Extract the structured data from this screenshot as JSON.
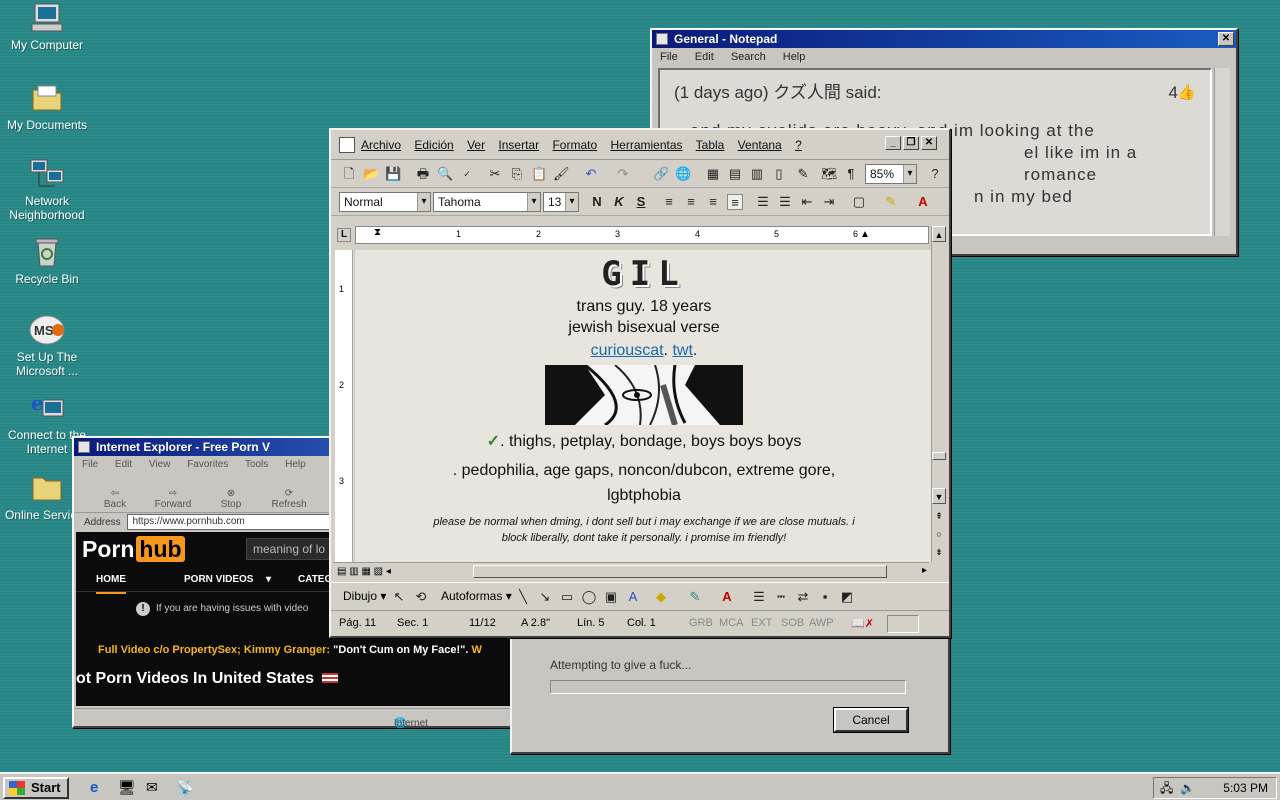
{
  "desktop": {
    "icons": [
      {
        "label": "My Computer",
        "icon": "computer-icon"
      },
      {
        "label": "My Documents",
        "icon": "folder-icon"
      },
      {
        "label": "Network Neighborhood",
        "icon": "network-icon"
      },
      {
        "label": "Recycle Bin",
        "icon": "recycle-bin-icon"
      },
      {
        "label": "Set Up The Microsoft ...",
        "icon": "msn-icon"
      },
      {
        "label": "Connect to the Internet",
        "icon": "internet-icon"
      },
      {
        "label": "Online Services",
        "icon": "folder-icon"
      }
    ]
  },
  "notepad": {
    "title": "General - Notepad",
    "menu": [
      "File",
      "Edit",
      "Search",
      "Help"
    ],
    "header": "(1 days ago) クズ人間 said:",
    "likes": "4",
    "body_line1": "and my eyelids are heavy, and im looking at the",
    "body_line2": "el like im in a romance",
    "body_line3": "n in my bed"
  },
  "ie": {
    "title": "Internet Explorer - Free Porn V",
    "menu": [
      "File",
      "Edit",
      "View",
      "Favorites",
      "Tools",
      "Help"
    ],
    "toolbar": [
      "Back",
      "Forward",
      "Stop",
      "Refresh",
      "Ho"
    ],
    "address_label": "Address",
    "address": "https://www.pornhub.com",
    "logo_left": "Porn",
    "logo_right": "hub",
    "search_placeholder": "meaning of lo",
    "nav": [
      "HOME",
      "PORN VIDEOS",
      "CATEG"
    ],
    "notice": "If you are having issues with video",
    "promo_yellow": "Full Video c/o PropertySex; Kimmy Granger:",
    "promo_white": "\"Don't Cum on My Face!\".",
    "promo_tail": "W",
    "heading": "ot Porn Videos In United States",
    "status": "Internet"
  },
  "dialog": {
    "text": "Attempting to give a fuck...",
    "cancel": "Cancel"
  },
  "word": {
    "menu": [
      "Archivo",
      "Edición",
      "Ver",
      "Insertar",
      "Formato",
      "Herramientas",
      "Tabla",
      "Ventana",
      "?"
    ],
    "zoom": "85%",
    "style": "Normal",
    "font": "Tahoma",
    "size": "13",
    "ruler_numbers": [
      "1",
      "2",
      "3",
      "4",
      "5",
      "6"
    ],
    "vruler_numbers": [
      "1",
      "2",
      "3"
    ],
    "doc": {
      "title": "GIL",
      "line1": "trans guy. 18 years",
      "line2": "jewish bisexual verse",
      "link1": "curiouscat",
      "sep": ".",
      "link2": "twt",
      "end": ".",
      "check": "✓",
      "likes": ". thighs, petplay, bondage, boys boys boys",
      "dislikes_1": ". pedophilia, age gaps, noncon/dubcon, extreme gore,",
      "dislikes_2": "lgbtphobia",
      "small_1": "please be normal when dming, i dont sell but i may exchange if we are close mutuals. i",
      "small_2": "block liberally, dont take it personally. i promise im friendly!"
    },
    "draw": {
      "dibujo": "Dibujo",
      "autoformas": "Autoformas"
    },
    "status": {
      "pag": "Pág. 11",
      "sec": "Sec. 1",
      "pages": "11/12",
      "at": "A 2.8\"",
      "lin": "Lín. 5",
      "col": "Col. 1",
      "grb": "GRB",
      "mca": "MCA",
      "ext": "EXT",
      "sob": "SOB",
      "awp": "AWP"
    }
  },
  "taskbar": {
    "start": "Start",
    "clock": "5:03 PM"
  },
  "colors": {
    "desktop": "#2b8a8a",
    "titlebar": "#0a1a7a",
    "link": "#1a6ab0",
    "hub_orange": "#f7971d"
  }
}
